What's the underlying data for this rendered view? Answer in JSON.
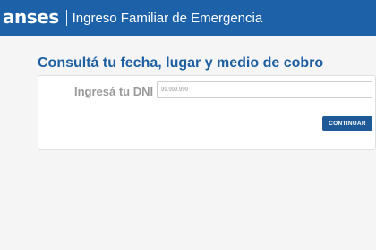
{
  "header": {
    "brand": "anses",
    "title": "Ingreso Familiar de Emergencia"
  },
  "main": {
    "title": "Consultá tu fecha, lugar y medio de cobro",
    "form": {
      "dni_label": "Ingresá tu DNI",
      "dni_value": "",
      "dni_placeholder": "99.999.999",
      "submit_label": "CONTINUAR"
    }
  },
  "colors": {
    "header_bg": "#1d62a8",
    "title": "#1d5fa0",
    "button_bg": "#1d5a97"
  }
}
